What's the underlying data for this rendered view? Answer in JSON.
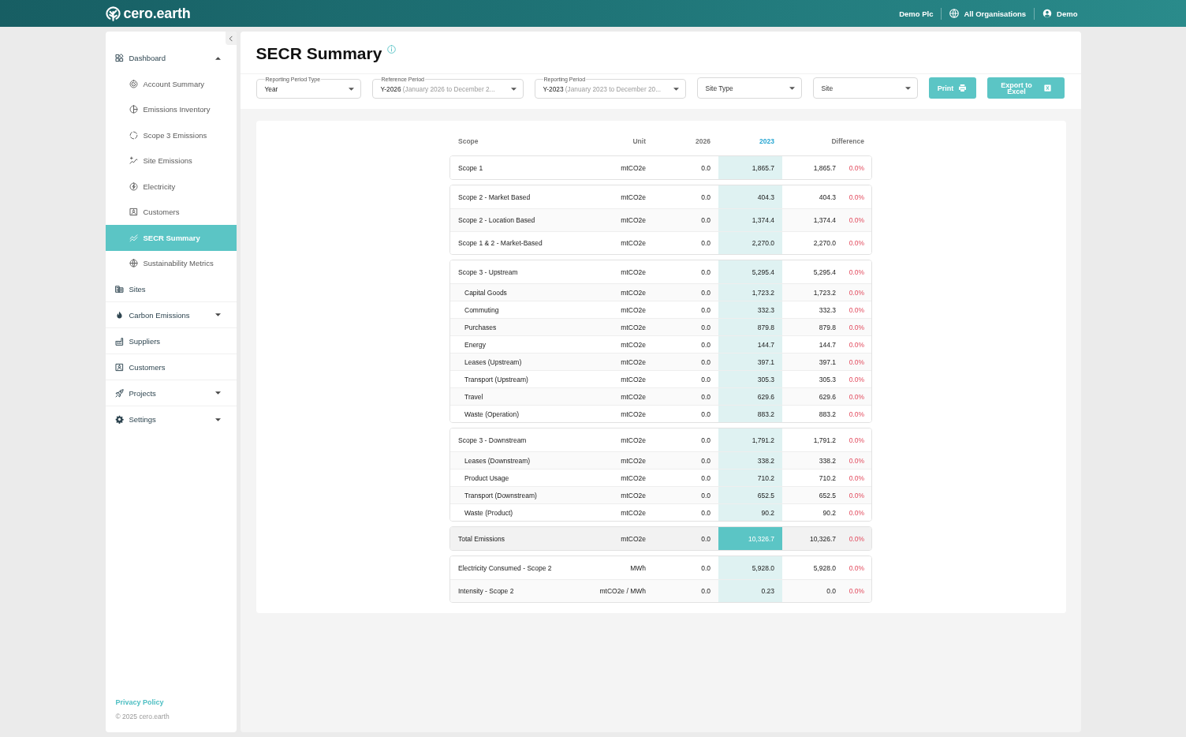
{
  "top_bar": {
    "logo": "cero.earth",
    "company": "Demo Plc",
    "organisations": "All Organisations",
    "user": "Demo"
  },
  "sidebar": {
    "items": [
      {
        "label": "Dashboard",
        "expanded": true,
        "selected": false,
        "children": [
          {
            "label": "Account Summary",
            "selected": false
          },
          {
            "label": "Emissions Inventory",
            "selected": false
          },
          {
            "label": "Scope 3 Emissions",
            "selected": false
          },
          {
            "label": "Site Emissions",
            "selected": false
          },
          {
            "label": "Electricity",
            "selected": false
          },
          {
            "label": "Customers",
            "selected": false
          },
          {
            "label": "SECR Summary",
            "selected": true
          },
          {
            "label": "Sustainability Metrics",
            "selected": false
          }
        ]
      },
      {
        "label": "Sites",
        "selected": false
      },
      {
        "label": "Carbon Emissions",
        "expanded": false,
        "selected": false
      },
      {
        "label": "Suppliers",
        "selected": false
      },
      {
        "label": "Customers",
        "selected": false
      },
      {
        "label": "Projects",
        "expanded": false,
        "selected": false
      },
      {
        "label": "Settings",
        "expanded": false,
        "selected": false
      }
    ],
    "privacy_link": "Privacy Policy",
    "copyright": "© 2025 cero.earth"
  },
  "page": {
    "title": "SECR Summary"
  },
  "filters": [
    {
      "kind": "labeled",
      "label": "Reporting Period Type",
      "value": "Year"
    },
    {
      "kind": "labeled",
      "label": "Reference Period",
      "value": "Y-2026",
      "detail": "(January 2026 to December 2..."
    },
    {
      "kind": "labeled",
      "label": "Reporting Period",
      "value": "Y-2023",
      "detail": "(January 2023 to December 20..."
    },
    {
      "kind": "placeholder",
      "placeholder": "Site Type"
    },
    {
      "kind": "placeholder",
      "placeholder": "Site"
    }
  ],
  "buttons": [
    {
      "label": "Print"
    },
    {
      "label": "Export to Excel"
    }
  ],
  "table": {
    "columns": [
      {
        "label": "Scope",
        "highlighted": false
      },
      {
        "label": "Unit",
        "highlighted": false
      },
      {
        "label": "2026",
        "highlighted": false
      },
      {
        "label": "2023",
        "highlighted": true
      },
      {
        "label": "Difference",
        "highlighted": false
      }
    ],
    "groups": [
      {
        "rows": [
          {
            "kind": "standard",
            "cells": [
              "Scope 1",
              "mtCO2e",
              "0.0",
              "1,865.7",
              "1,865.7",
              "0.0%"
            ]
          }
        ]
      },
      {
        "rows": [
          {
            "kind": "standard",
            "cells": [
              "Scope 2 - Market Based",
              "mtCO2e",
              "0.0",
              "404.3",
              "404.3",
              "0.0%"
            ]
          },
          {
            "kind": "standard",
            "cells": [
              "Scope 2 - Location Based",
              "mtCO2e",
              "0.0",
              "1,374.4",
              "1,374.4",
              "0.0%"
            ]
          },
          {
            "kind": "standard",
            "cells": [
              "Scope 1 & 2 - Market-Based",
              "mtCO2e",
              "0.0",
              "2,270.0",
              "2,270.0",
              "0.0%"
            ]
          }
        ]
      },
      {
        "rows": [
          {
            "kind": "standard",
            "cells": [
              "Scope 3 - Upstream",
              "mtCO2e",
              "0.0",
              "5,295.4",
              "5,295.4",
              "0.0%"
            ],
            "children": [
              {
                "cells": [
                  "Capital Goods",
                  "mtCO2e",
                  "0.0",
                  "1,723.2",
                  "1,723.2",
                  "0.0%"
                ]
              },
              {
                "cells": [
                  "Commuting",
                  "mtCO2e",
                  "0.0",
                  "332.3",
                  "332.3",
                  "0.0%"
                ]
              },
              {
                "cells": [
                  "Purchases",
                  "mtCO2e",
                  "0.0",
                  "879.8",
                  "879.8",
                  "0.0%"
                ]
              },
              {
                "cells": [
                  "Energy",
                  "mtCO2e",
                  "0.0",
                  "144.7",
                  "144.7",
                  "0.0%"
                ]
              },
              {
                "cells": [
                  "Leases (Upstream)",
                  "mtCO2e",
                  "0.0",
                  "397.1",
                  "397.1",
                  "0.0%"
                ]
              },
              {
                "cells": [
                  "Transport (Upstream)",
                  "mtCO2e",
                  "0.0",
                  "305.3",
                  "305.3",
                  "0.0%"
                ]
              },
              {
                "cells": [
                  "Travel",
                  "mtCO2e",
                  "0.0",
                  "629.6",
                  "629.6",
                  "0.0%"
                ]
              },
              {
                "cells": [
                  "Waste (Operation)",
                  "mtCO2e",
                  "0.0",
                  "883.2",
                  "883.2",
                  "0.0%"
                ]
              }
            ]
          }
        ]
      },
      {
        "rows": [
          {
            "kind": "standard",
            "cells": [
              "Scope 3 - Downstream",
              "mtCO2e",
              "0.0",
              "1,791.2",
              "1,791.2",
              "0.0%"
            ],
            "children": [
              {
                "cells": [
                  "Leases (Downstream)",
                  "mtCO2e",
                  "0.0",
                  "338.2",
                  "338.2",
                  "0.0%"
                ]
              },
              {
                "cells": [
                  "Product Usage",
                  "mtCO2e",
                  "0.0",
                  "710.2",
                  "710.2",
                  "0.0%"
                ]
              },
              {
                "cells": [
                  "Transport (Downstream)",
                  "mtCO2e",
                  "0.0",
                  "652.5",
                  "652.5",
                  "0.0%"
                ]
              },
              {
                "cells": [
                  "Waste (Product)",
                  "mtCO2e",
                  "0.0",
                  "90.2",
                  "90.2",
                  "0.0%"
                ]
              }
            ]
          }
        ]
      },
      {
        "rows": [
          {
            "kind": "total",
            "cells": [
              "Total Emissions",
              "mtCO2e",
              "0.0",
              "10,326.7",
              "10,326.7",
              "0.0%"
            ]
          }
        ]
      },
      {
        "rows": [
          {
            "kind": "standard",
            "cells": [
              "Electricity Consumed - Scope 2",
              "MWh",
              "0.0",
              "5,928.0",
              "5,928.0",
              "0.0%"
            ]
          },
          {
            "kind": "standard",
            "cells": [
              "Intensity - Scope 2",
              "mtCO2e / MWh",
              "0.0",
              "0.23",
              "0.0",
              "0.0%"
            ]
          }
        ]
      }
    ]
  }
}
